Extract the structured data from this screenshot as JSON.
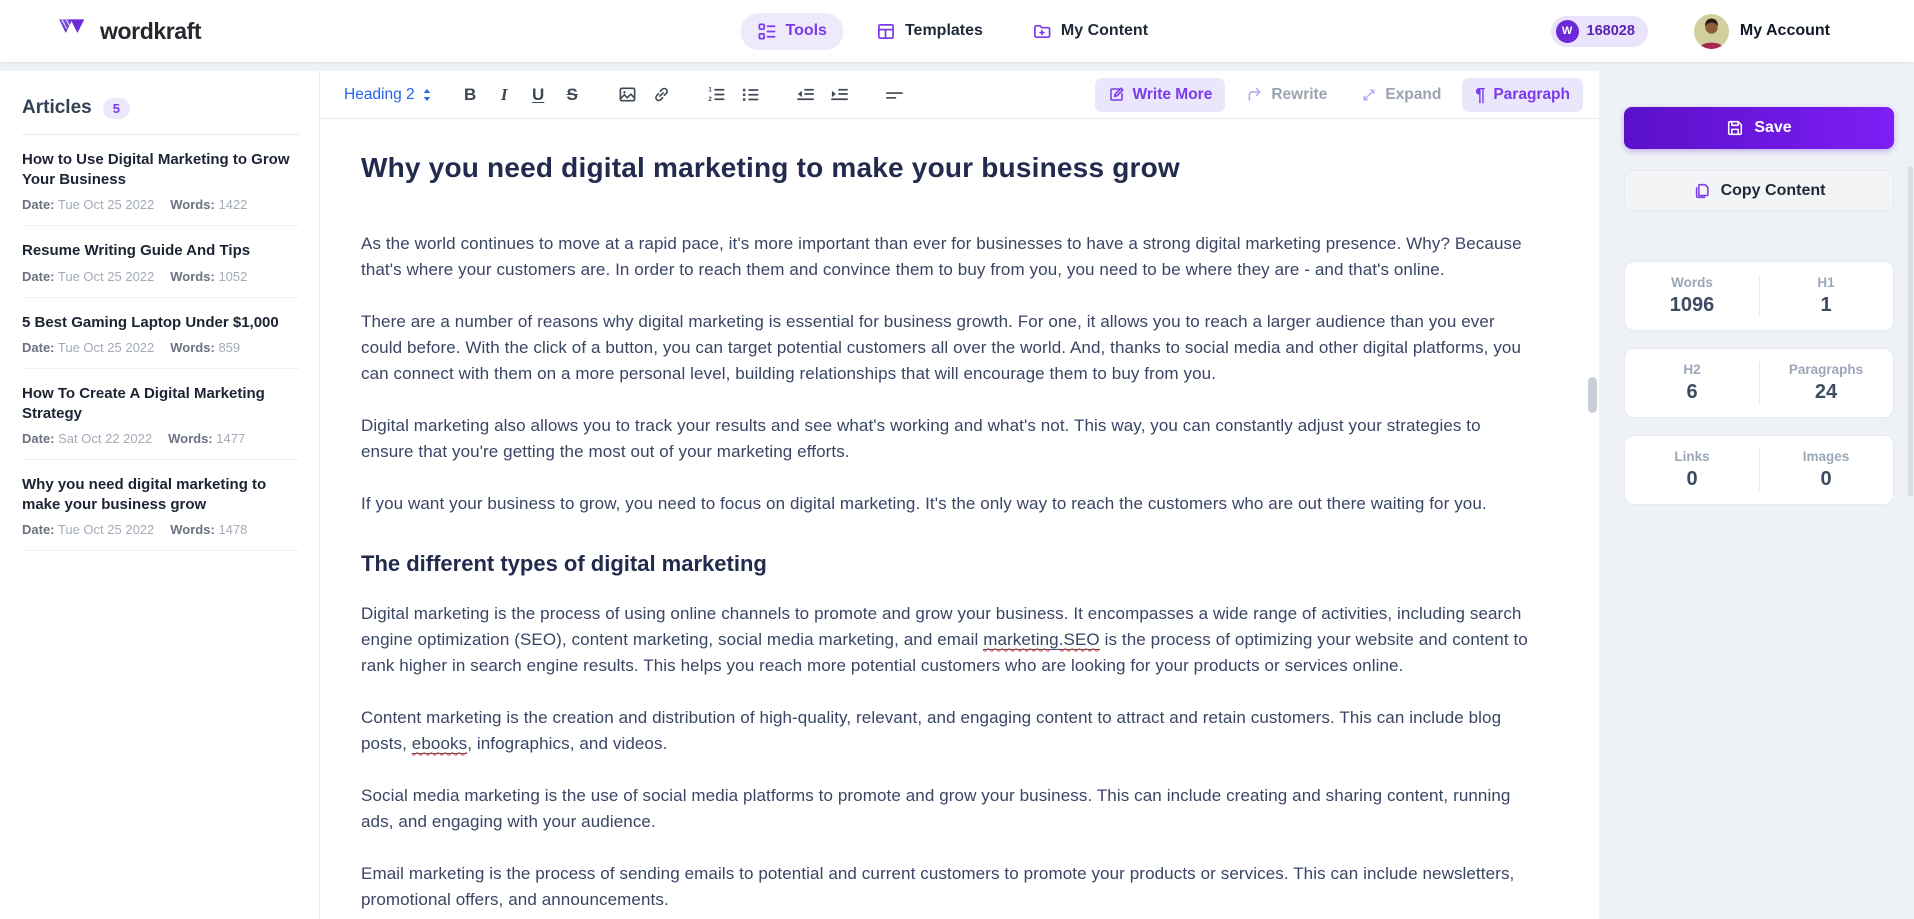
{
  "brand": {
    "name": "wordkraft"
  },
  "colors": {
    "accent": "#7c3aed",
    "save_gradient_start": "#5a10c8",
    "save_gradient_end": "#7d1ef5",
    "heading_select_blue": "#2563eb",
    "spellcheck_red": "#d64541"
  },
  "nav": {
    "tabs": [
      {
        "label": "Tools",
        "active": true
      },
      {
        "label": "Templates",
        "active": false
      },
      {
        "label": "My Content",
        "active": false
      }
    ],
    "token_monogram": "W",
    "tokens": "168028",
    "account_label": "My Account"
  },
  "sidebar": {
    "title": "Articles",
    "count": "5",
    "date_label": "Date:",
    "words_label": "Words:",
    "articles": [
      {
        "title": "How to Use Digital Marketing to Grow Your Business",
        "date": "Tue Oct 25 2022",
        "words": "1422"
      },
      {
        "title": "Resume Writing Guide And Tips",
        "date": "Tue Oct 25 2022",
        "words": "1052"
      },
      {
        "title": "5 Best Gaming Laptop Under $1,000",
        "date": "Tue Oct 25 2022",
        "words": "859"
      },
      {
        "title": "How To Create A Digital Marketing Strategy",
        "date": "Sat Oct 22 2022",
        "words": "1477"
      },
      {
        "title": "Why you need digital marketing to make your business grow",
        "date": "Tue Oct 25 2022",
        "words": "1478"
      }
    ]
  },
  "toolbar": {
    "heading_select": "Heading 2",
    "actions": [
      {
        "label": "Write More",
        "enabled": true
      },
      {
        "label": "Rewrite",
        "enabled": false
      },
      {
        "label": "Expand",
        "enabled": false
      },
      {
        "label": "Paragraph",
        "enabled": true
      }
    ]
  },
  "editor": {
    "blocks": [
      {
        "type": "h1",
        "text": "Why you need digital marketing to make your business grow"
      },
      {
        "type": "p",
        "text": "As the world continues to move at a rapid pace, it's more important than ever for businesses to have a strong digital marketing presence. Why? Because that's where your customers are. In order to reach them and convince them to buy from you, you need to be where they are - and that's online."
      },
      {
        "type": "p",
        "text": "There are a number of reasons why digital marketing is essential for business growth. For one, it allows you to reach a larger audience than you ever could before. With the click of a button, you can target potential customers all over the world. And, thanks to social media and other digital platforms, you can connect with them on a more personal level, building relationships that will encourage them to buy from you."
      },
      {
        "type": "p",
        "text": "Digital marketing also allows you to track your results and see what's working and what's not. This way, you can constantly adjust your strategies to ensure that you're getting the most out of your marketing efforts."
      },
      {
        "type": "p",
        "text": "If you want your business to grow, you need to focus on digital marketing. It's the only way to reach the customers who are out there waiting for you."
      },
      {
        "type": "h2",
        "text": "The different types of digital marketing"
      },
      {
        "type": "p",
        "pre": "Digital marketing is the process of using online channels to promote and grow your business. It encompasses a wide range of activities, including search engine optimization (SEO), content marketing, social media marketing, and email ",
        "mark": "marketing.SEO",
        "post": " is the process of optimizing your website and content to rank higher in search engine results. This helps you reach more potential customers who are looking for your products or services online."
      },
      {
        "type": "p",
        "pre": "Content marketing is the creation and distribution of high-quality, relevant, and engaging content to attract and retain customers. This can include blog posts, ",
        "mark": "ebooks",
        "post": ", infographics, and videos."
      },
      {
        "type": "p",
        "text": "Social media marketing is the use of social media platforms to promote and grow your business. This can include creating and sharing content, running ads, and engaging with your audience."
      },
      {
        "type": "p",
        "text": "Email marketing is the process of sending emails to potential and current customers to promote your products or services. This can include newsletters, promotional offers, and announcements."
      }
    ]
  },
  "panel": {
    "save_label": "Save",
    "copy_label": "Copy Content",
    "stats": [
      {
        "label": "Words",
        "value": "1096"
      },
      {
        "label": "H1",
        "value": "1"
      },
      {
        "label": "H2",
        "value": "6"
      },
      {
        "label": "Paragraphs",
        "value": "24"
      },
      {
        "label": "Links",
        "value": "0"
      },
      {
        "label": "Images",
        "value": "0"
      }
    ]
  }
}
